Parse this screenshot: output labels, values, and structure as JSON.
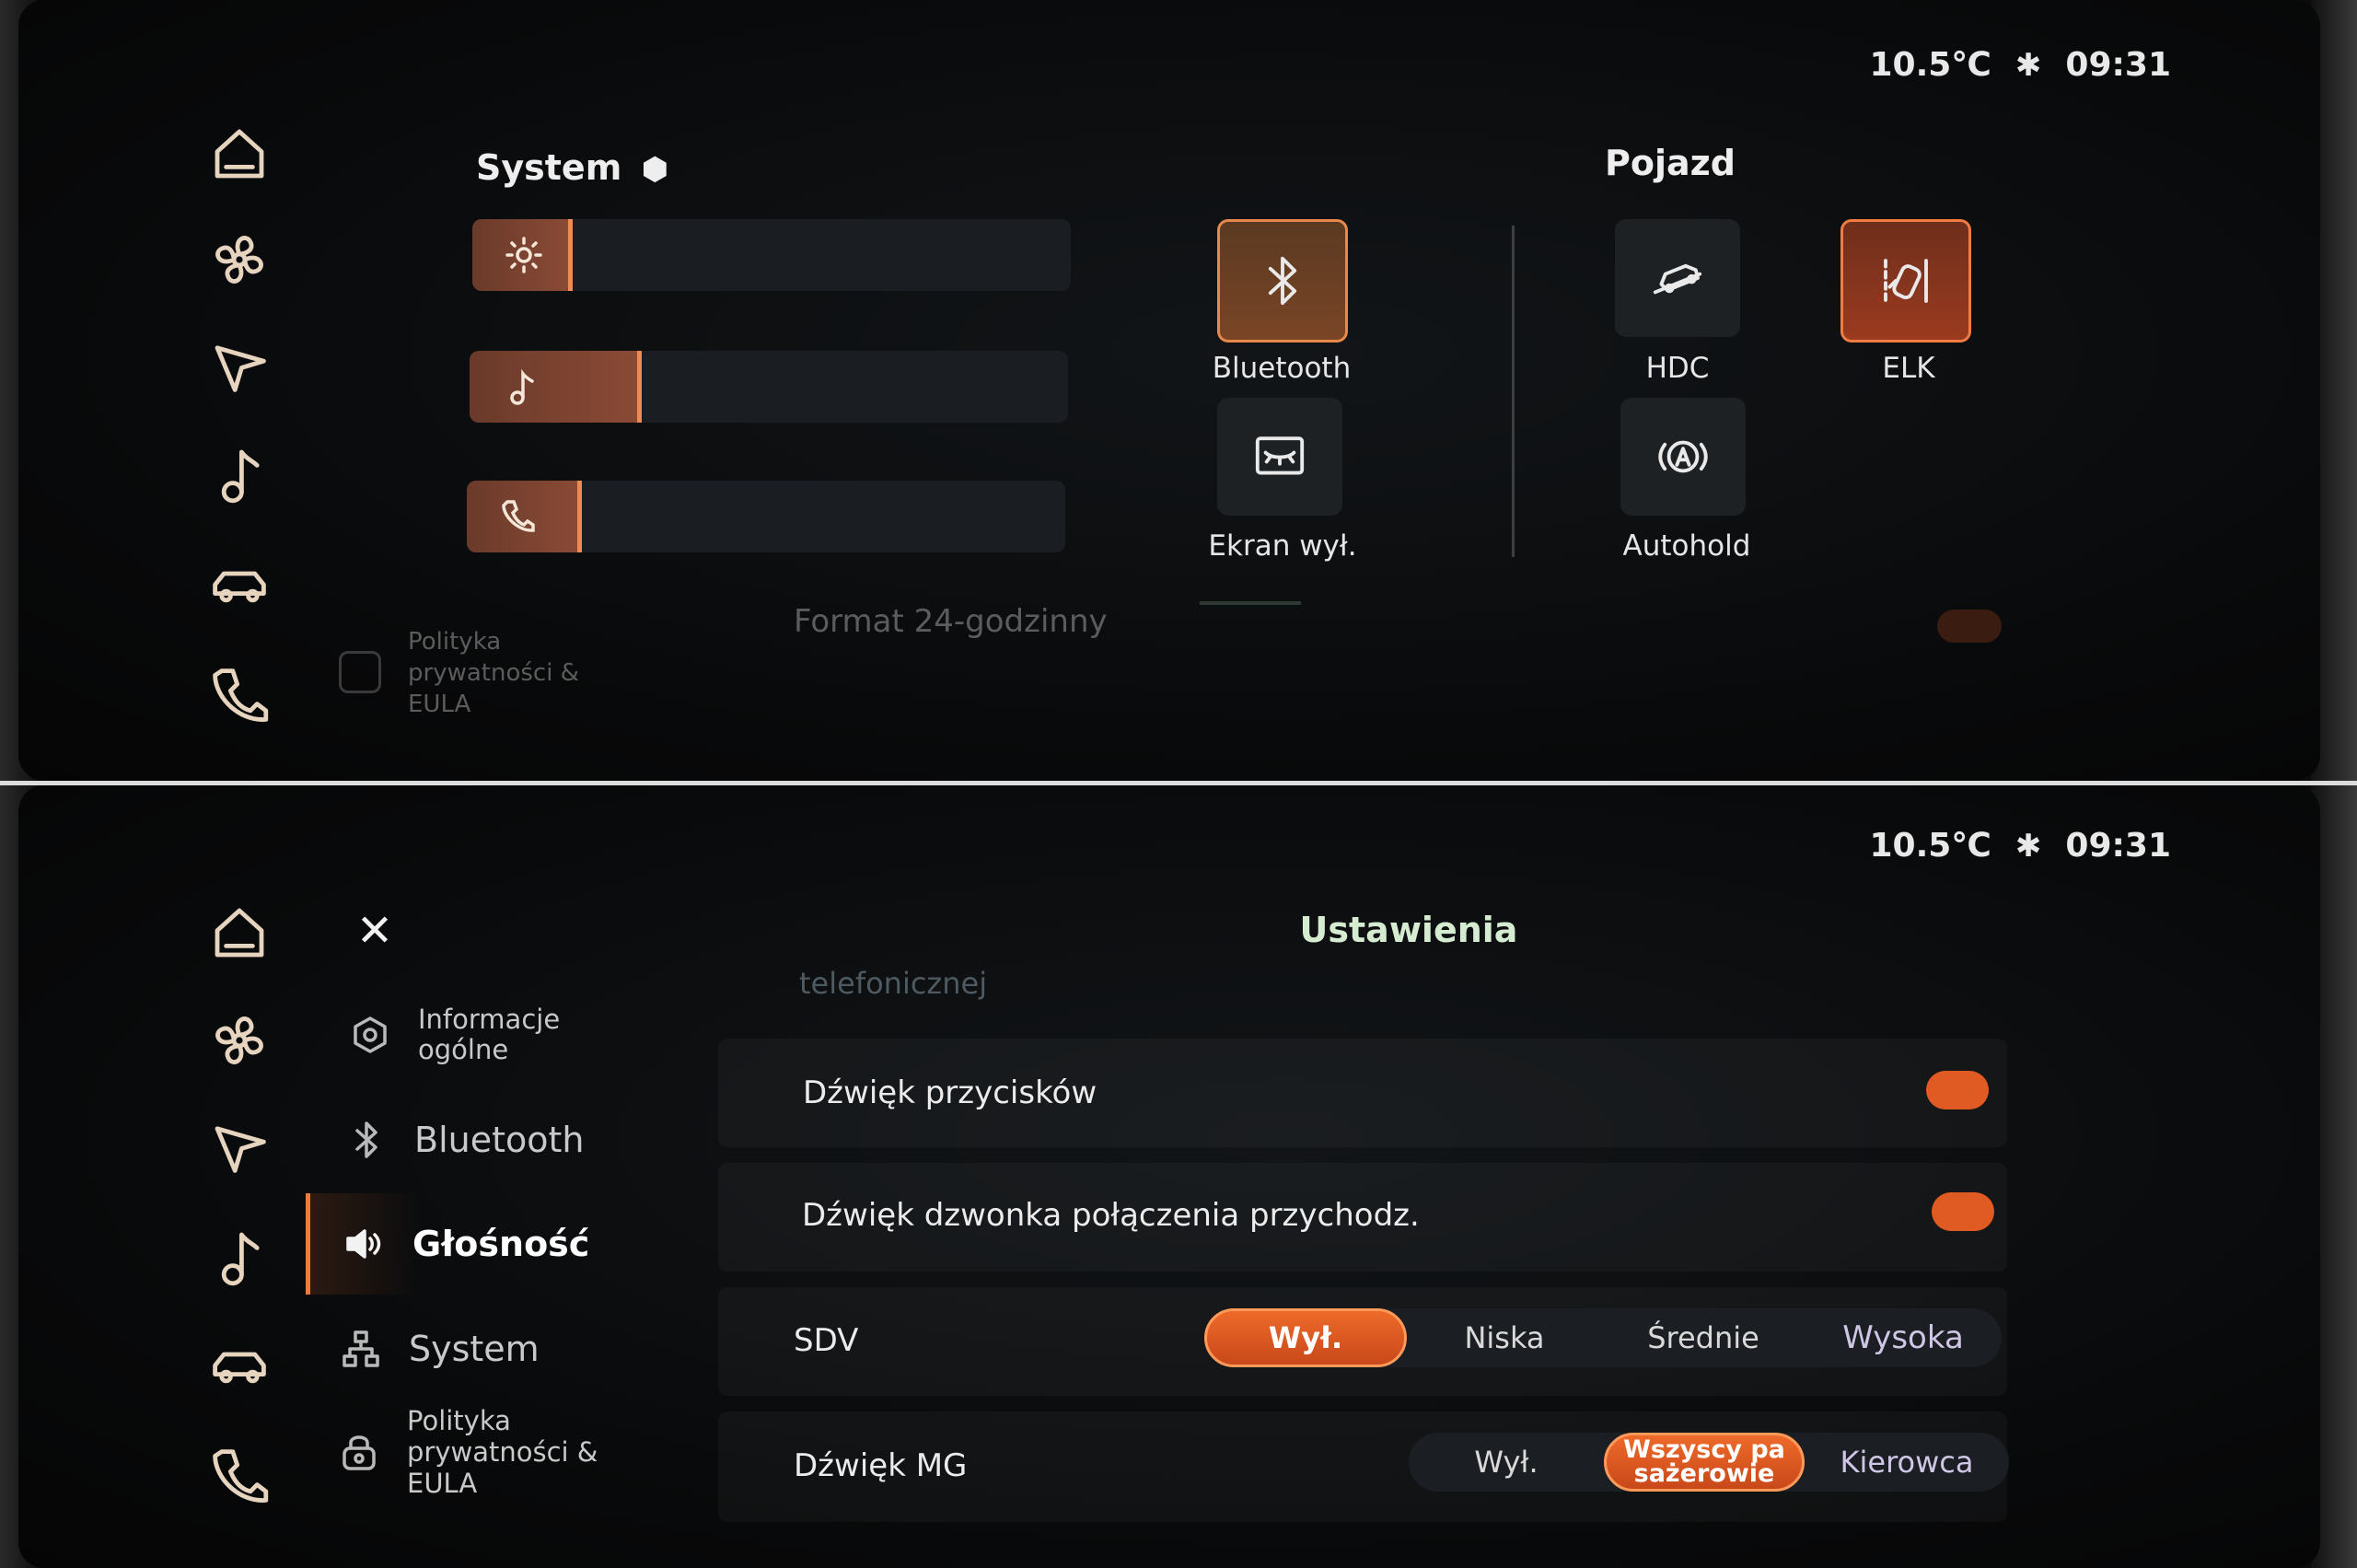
{
  "status": {
    "temperature": "10.5℃",
    "time": "09:31",
    "bluetooth_icon": "bluetooth-icon"
  },
  "sidebar": {
    "icons": [
      "home-icon",
      "fan-icon",
      "navigation-icon",
      "music-icon",
      "car-icon",
      "phone-icon"
    ]
  },
  "quick_panel": {
    "system_title": "System",
    "vehicle_title": "Pojazd",
    "sliders": [
      {
        "icon": "brightness-icon",
        "level": 0.16
      },
      {
        "icon": "music-note-icon",
        "level": 0.28
      },
      {
        "icon": "phone-icon",
        "level": 0.19
      }
    ],
    "tiles": [
      {
        "label": "Bluetooth",
        "icon": "bluetooth-icon",
        "active": true
      },
      {
        "label": "Ekran wył.",
        "icon": "screen-off-icon",
        "active": false
      },
      {
        "label": "HDC",
        "icon": "hill-descent-icon",
        "active": false
      },
      {
        "label": "ELK",
        "icon": "lane-keep-icon",
        "active": true
      },
      {
        "label": "Autohold",
        "icon": "autohold-icon",
        "active": false
      }
    ],
    "ghost_text": {
      "format": "Format 24-godzinny",
      "privacy": [
        "Polityka",
        "prywatności &",
        "EULA"
      ]
    }
  },
  "settings": {
    "title": "Ustawienia",
    "close_icon": "✕",
    "menu": [
      {
        "label": "Informacje",
        "label2": "ogólne",
        "icon": "info-hex-icon"
      },
      {
        "label": "Bluetooth",
        "icon": "bluetooth-icon"
      },
      {
        "label": "Głośność",
        "icon": "speaker-icon",
        "active": true
      },
      {
        "label": "System",
        "icon": "system-tree-icon"
      },
      {
        "label": "Polityka",
        "label2": "prywatności &",
        "label3": "EULA",
        "icon": "lock-icon"
      }
    ],
    "scrolled_text": "telefonicznej",
    "rows": [
      {
        "label": "Dźwięk przycisków",
        "toggle": true
      },
      {
        "label": "Dźwięk dzwonka połączenia przychodz.",
        "toggle": true
      }
    ],
    "sdv": {
      "label": "SDV",
      "options": [
        "Wył.",
        "Niska",
        "Średnie",
        "Wysoka"
      ],
      "selected": "Wył."
    },
    "mg_sound": {
      "label": "Dźwięk MG",
      "options": [
        "Wył.",
        "Wszyscy pa sażerowie",
        "Kierowca"
      ],
      "selected_line1": "Wszyscy pa",
      "selected_line2": "sażerowie",
      "selected": "Wszyscy pa sażerowie"
    }
  },
  "colors": {
    "accent": "#ee6a2a",
    "title_green": "#d6ecd0",
    "tile_bg": "#1d2124"
  }
}
